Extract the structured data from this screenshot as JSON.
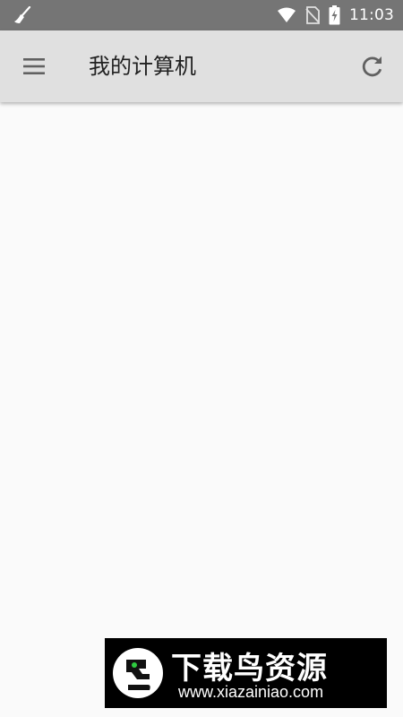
{
  "status_bar": {
    "time": "11:03",
    "icons": [
      "broom-icon",
      "wifi-icon",
      "no-sim-icon",
      "battery-charging-icon"
    ]
  },
  "toolbar": {
    "title": "我的计算机",
    "menu_icon": "hamburger-menu-icon",
    "refresh_icon": "refresh-icon"
  },
  "watermark": {
    "title": "下载鸟资源",
    "url": "www.xiazainiao.com"
  },
  "colors": {
    "status_bar_bg": "#757575",
    "toolbar_bg": "#e0e0e0",
    "content_bg": "#fafafa",
    "icon_color": "#616161",
    "watermark_accent": "#2ecc40"
  }
}
